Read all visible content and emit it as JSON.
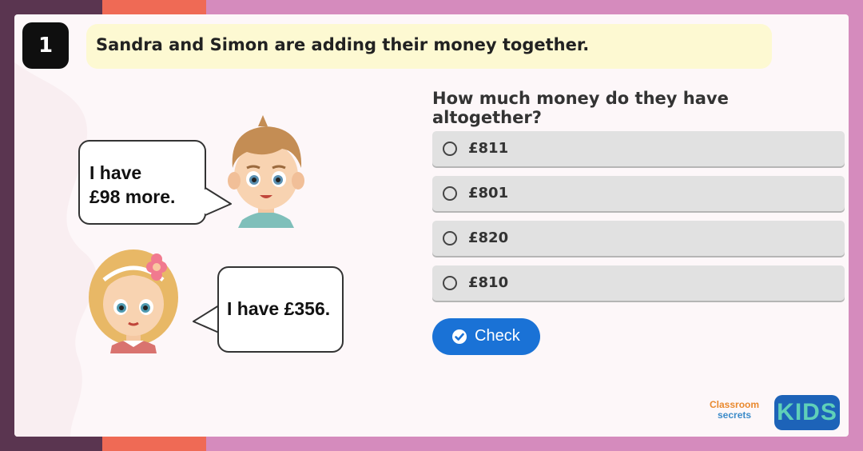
{
  "question_number": "1",
  "title": "Sandra and Simon are adding their money together.",
  "question": "How much money do they have altogether?",
  "options": [
    {
      "label": "£811"
    },
    {
      "label": "£801"
    },
    {
      "label": "£820"
    },
    {
      "label": "£810"
    }
  ],
  "check_button": {
    "label": "Check",
    "icon": "check-circle-icon"
  },
  "speech": {
    "simon_line1": "I have",
    "simon_line2": "£98 more.",
    "sandra": "I have £356."
  },
  "branding": {
    "classroom": "Classroom",
    "secrets": "secrets",
    "kids": "KIDS"
  },
  "colors": {
    "accent_blue": "#1a72d6",
    "title_bg": "#fdf9d2",
    "option_bg": "#e1e1e1",
    "frame_pink": "#d58bbd",
    "frame_red": "#ef6a55",
    "frame_purple": "#5a3550"
  }
}
